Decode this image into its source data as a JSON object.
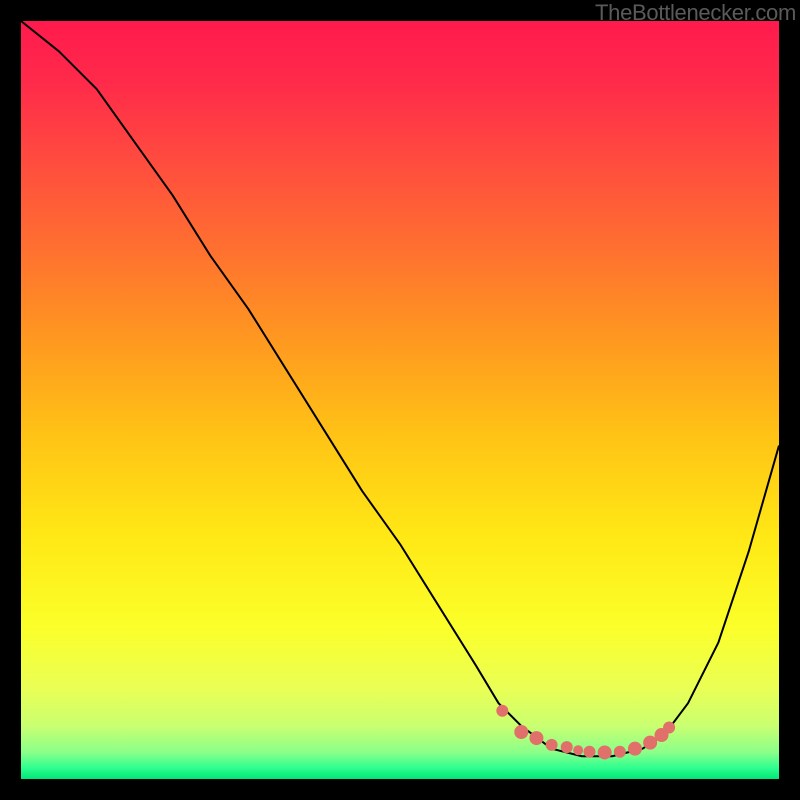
{
  "watermark": "TheBottlenecker.com",
  "chart_data": {
    "type": "line",
    "title": "",
    "xlabel": "",
    "ylabel": "",
    "xlim": [
      0,
      100
    ],
    "ylim": [
      0,
      100
    ],
    "grid": false,
    "series": [
      {
        "name": "curve",
        "x": [
          0,
          5,
          10,
          15,
          20,
          25,
          30,
          35,
          40,
          45,
          50,
          55,
          60,
          63,
          66,
          70,
          74,
          78,
          82,
          85,
          88,
          92,
          96,
          100
        ],
        "values": [
          100,
          96,
          91,
          84,
          77,
          69,
          62,
          54,
          46,
          38,
          31,
          23,
          15,
          10,
          7,
          4,
          3,
          3,
          4,
          6,
          10,
          18,
          30,
          44
        ],
        "color": "#000000",
        "width": 2
      }
    ],
    "markers": [
      {
        "x": 63.5,
        "y": 9.0,
        "r": 6
      },
      {
        "x": 66.0,
        "y": 6.2,
        "r": 7
      },
      {
        "x": 68.0,
        "y": 5.4,
        "r": 7
      },
      {
        "x": 70.0,
        "y": 4.5,
        "r": 6
      },
      {
        "x": 72.0,
        "y": 4.2,
        "r": 6
      },
      {
        "x": 73.5,
        "y": 3.8,
        "r": 5
      },
      {
        "x": 75.0,
        "y": 3.6,
        "r": 6
      },
      {
        "x": 77.0,
        "y": 3.5,
        "r": 7
      },
      {
        "x": 79.0,
        "y": 3.6,
        "r": 6
      },
      {
        "x": 81.0,
        "y": 4.0,
        "r": 7
      },
      {
        "x": 83.0,
        "y": 4.8,
        "r": 7
      },
      {
        "x": 84.5,
        "y": 5.8,
        "r": 7
      },
      {
        "x": 85.5,
        "y": 6.8,
        "r": 6
      }
    ],
    "marker_color": "#e2706a",
    "gradient_stops": [
      {
        "offset": 0.0,
        "color": "#ff1a4d"
      },
      {
        "offset": 0.08,
        "color": "#ff2a4a"
      },
      {
        "offset": 0.18,
        "color": "#ff4a3f"
      },
      {
        "offset": 0.3,
        "color": "#ff7030"
      },
      {
        "offset": 0.42,
        "color": "#ff9820"
      },
      {
        "offset": 0.55,
        "color": "#ffc415"
      },
      {
        "offset": 0.68,
        "color": "#ffe815"
      },
      {
        "offset": 0.8,
        "color": "#fbff2a"
      },
      {
        "offset": 0.88,
        "color": "#eaff55"
      },
      {
        "offset": 0.93,
        "color": "#c9ff70"
      },
      {
        "offset": 0.965,
        "color": "#8aff8a"
      },
      {
        "offset": 0.985,
        "color": "#30ff90"
      },
      {
        "offset": 1.0,
        "color": "#00e676"
      }
    ]
  }
}
